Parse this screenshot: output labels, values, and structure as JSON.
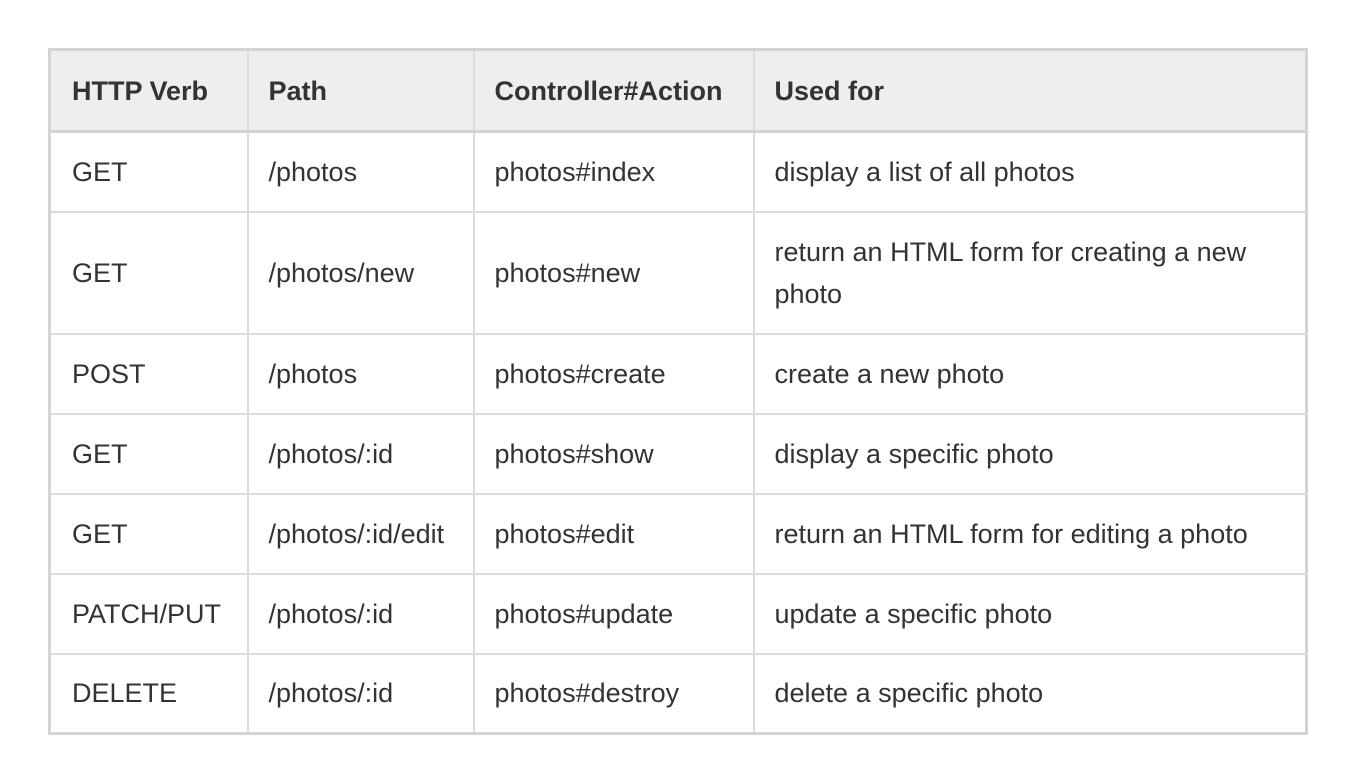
{
  "table": {
    "headers": [
      "HTTP Verb",
      "Path",
      "Controller#Action",
      "Used for"
    ],
    "rows": [
      [
        "GET",
        "/photos",
        "photos#index",
        "display a list of all photos"
      ],
      [
        "GET",
        "/photos/new",
        "photos#new",
        "return an HTML form for creating a new photo"
      ],
      [
        "POST",
        "/photos",
        "photos#create",
        "create a new photo"
      ],
      [
        "GET",
        "/photos/:id",
        "photos#show",
        "display a specific photo"
      ],
      [
        "GET",
        "/photos/:id/edit",
        "photos#edit",
        "return an HTML form for editing a photo"
      ],
      [
        "PATCH/PUT",
        "/photos/:id",
        "photos#update",
        "update a specific photo"
      ],
      [
        "DELETE",
        "/photos/:id",
        "photos#destroy",
        "delete a specific photo"
      ]
    ]
  },
  "colors": {
    "header_background": "#eeeeee",
    "border": "#d4d4d4",
    "text": "#333333"
  }
}
